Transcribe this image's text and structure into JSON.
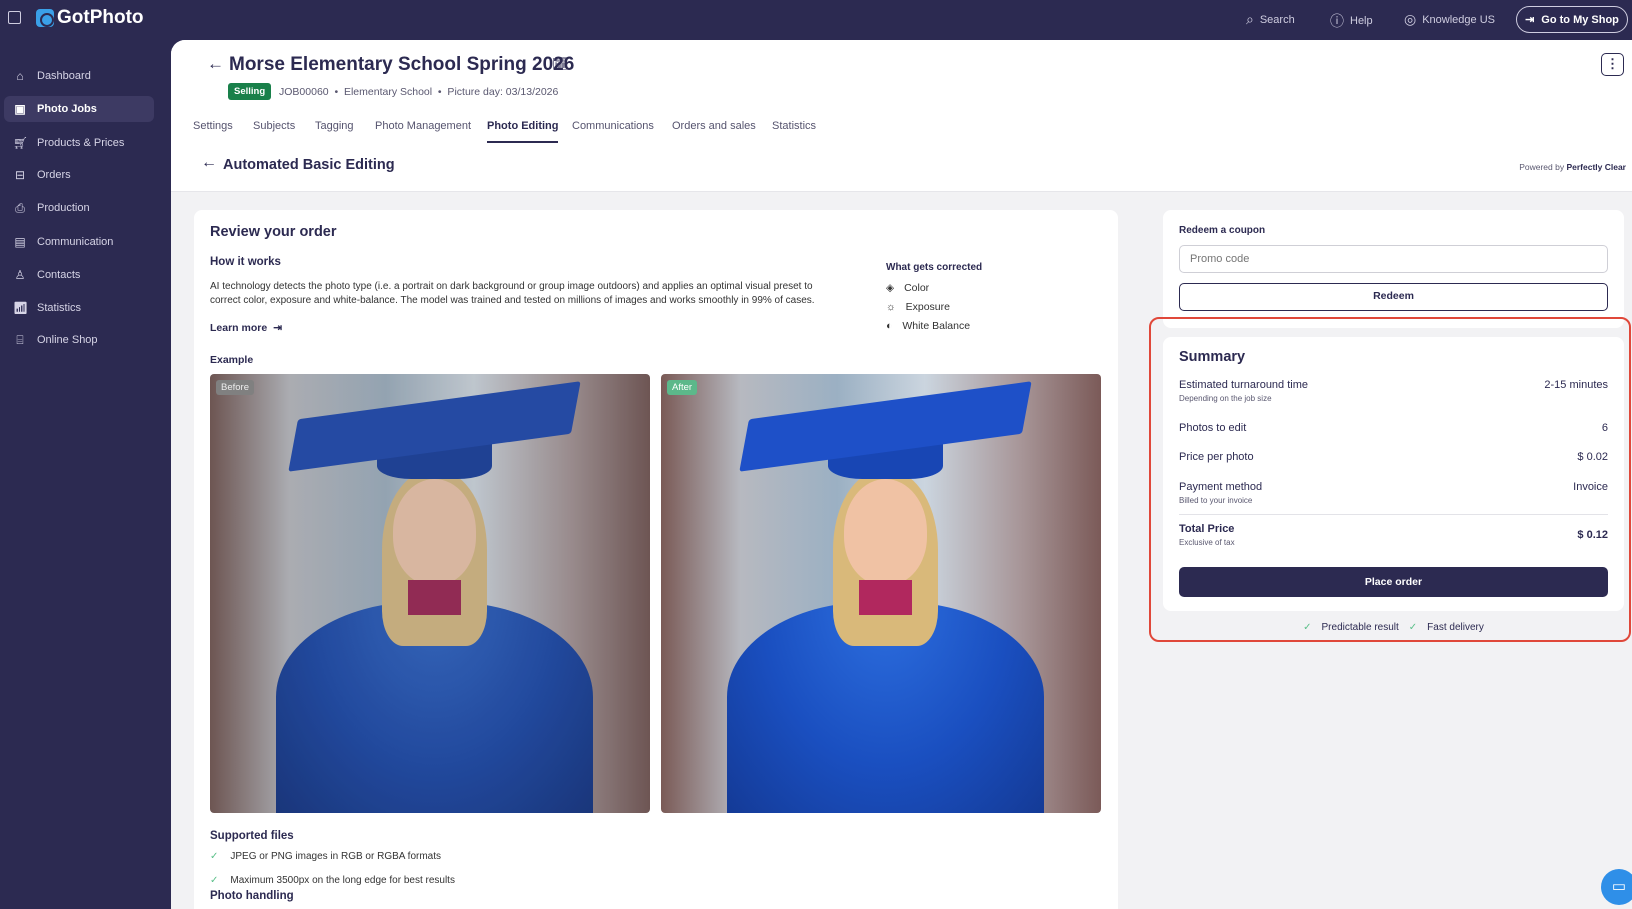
{
  "topbar": {
    "logo": "GotPhoto",
    "search": "Search",
    "help": "Help",
    "knowledge": "Knowledge US",
    "shop": "Go to My Shop"
  },
  "sidebar": {
    "items": [
      {
        "label": "Dashboard",
        "icon": "home-icon"
      },
      {
        "label": "Photo Jobs",
        "icon": "image-icon",
        "active": true
      },
      {
        "label": "Products & Prices",
        "icon": "cart-icon"
      },
      {
        "label": "Orders",
        "icon": "box-icon"
      },
      {
        "label": "Production",
        "icon": "printer-icon"
      },
      {
        "label": "Communication",
        "icon": "message-icon"
      },
      {
        "label": "Contacts",
        "icon": "person-icon"
      },
      {
        "label": "Statistics",
        "icon": "chart-icon"
      },
      {
        "label": "Online Shop",
        "icon": "store-icon"
      }
    ]
  },
  "job": {
    "title": "Morse Elementary School Spring 2026",
    "status": "Selling",
    "meta": "JOB00060  •  Elementary School  •  Picture day: 03/13/2026"
  },
  "tabs": [
    "Settings",
    "Subjects",
    "Tagging",
    "Photo Management",
    "Photo Editing",
    "Communications",
    "Orders and sales",
    "Statistics"
  ],
  "active_tab": "Photo Editing",
  "subheader": {
    "title": "Automated Basic Editing",
    "powered_prefix": "Powered by ",
    "powered_brand": "Perfectly Clear"
  },
  "review": {
    "title": "Review your order",
    "how_title": "How it works",
    "how_text": "AI technology detects the photo type (i.e. a portrait on dark background or group image outdoors) and applies an optimal visual preset to correct color, exposure and white-balance. The model was trained and tested on millions of images and works smoothly in 99% of cases.",
    "learn_more": "Learn more",
    "corrected_title": "What gets corrected",
    "corrected": [
      "Color",
      "Exposure",
      "White Balance"
    ],
    "example_title": "Example",
    "before": "Before",
    "after": "After",
    "supported_title": "Supported files",
    "supported": [
      "JPEG or PNG images in RGB or RGBA formats",
      "Maximum 3500px on the long edge for best results"
    ],
    "handling_title": "Photo handling"
  },
  "coupon": {
    "title": "Redeem a coupon",
    "placeholder": "Promo code",
    "button": "Redeem"
  },
  "summary": {
    "title": "Summary",
    "turnaround_label": "Estimated turnaround time",
    "turnaround_sub": "Depending on the job size",
    "turnaround_value": "2-15 minutes",
    "photos_label": "Photos to edit",
    "photos_value": "6",
    "price_label": "Price per photo",
    "price_value": "$ 0.02",
    "payment_label": "Payment method",
    "payment_sub": "Billed to your invoice",
    "payment_value": "Invoice",
    "total_label": "Total Price",
    "total_sub": "Exclusive of tax",
    "total_value": "$ 0.12",
    "button": "Place order",
    "benefits": [
      "Predictable result",
      "Fast delivery"
    ]
  },
  "colors": {
    "primary": "#2c2a51",
    "selling": "#19804a",
    "highlight": "#e0483a",
    "check": "#5cc08a"
  }
}
